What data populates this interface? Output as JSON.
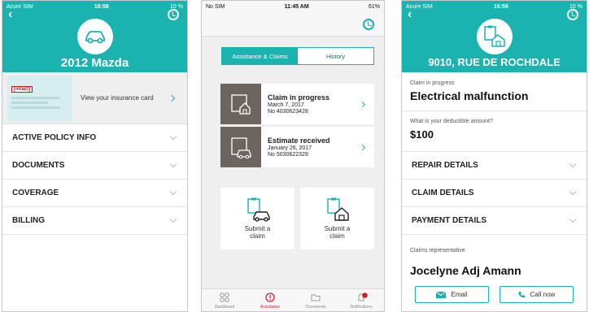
{
  "phone1": {
    "status": {
      "carrier": "Acure SIM",
      "time": "16:58",
      "battery": "10 %"
    },
    "title": "2012 Mazda",
    "card": {
      "brand": "[intact]",
      "label": "View your insurance card"
    },
    "sections": [
      "ACTIVE POLICY INFO",
      "DOCUMENTS",
      "COVERAGE",
      "BILLING"
    ]
  },
  "phone2": {
    "status": {
      "carrier": "No SIM",
      "time": "11:45 AM",
      "battery": "61%"
    },
    "tabs": [
      "Assistance & Claims",
      "History"
    ],
    "claims": [
      {
        "title": "Claim in progress",
        "date": "March 7, 2017",
        "number": "No 4030623428"
      },
      {
        "title": "Estimate received",
        "date": "January 26, 2017",
        "number": "No 5030622329"
      }
    ],
    "tiles": [
      {
        "line1": "Submit a",
        "line2": "claim"
      },
      {
        "line1": "Submit a",
        "line2": "claim"
      }
    ],
    "tabbar": [
      "Dashboard",
      "Assistance",
      "Documents",
      "Notifications"
    ]
  },
  "phone3": {
    "status": {
      "carrier": "Acure SIM",
      "time": "16:59",
      "battery": "10 %"
    },
    "title": "9010, RUE DE ROCHDALE",
    "claim_label": "Claim in progress",
    "claim_value": "Electrical malfunction",
    "deductible_label": "What is your deductible amount?",
    "deductible_value": "$100",
    "sections": [
      "REPAIR DETAILS",
      "CLAIM DETAILS",
      "PAYMENT DETAILS"
    ],
    "rep_label": "Claims representative",
    "rep_name": "Jocelyne Adj Amann",
    "email_label": "Email",
    "call_label": "Call now"
  },
  "colors": {
    "accent": "#1ab3b0",
    "alert": "#d21f33",
    "icon_bg": "#6b6460"
  }
}
